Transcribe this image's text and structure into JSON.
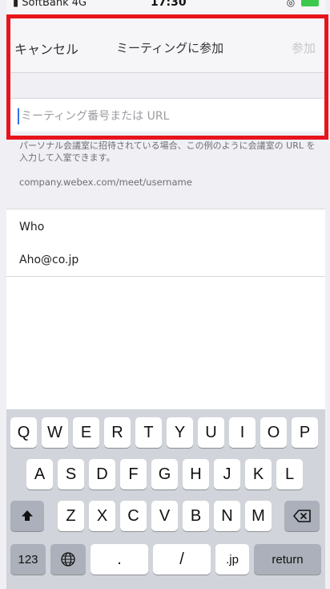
{
  "status_bar": {
    "carrier": "SoftBank",
    "network": "4G",
    "time": "17:30"
  },
  "nav": {
    "cancel_label": "キャンセル",
    "title": "ミーティングに参加",
    "join_label": "参加"
  },
  "meeting_input": {
    "placeholder": "ミーティング番号または URL",
    "value": ""
  },
  "help": {
    "text": "パーソナル会議室に招待されている場合、この例のように会議室の URL を入力して入室できます。",
    "example": "company.webex.com/meet/username"
  },
  "fields": {
    "name_value": "Who",
    "email_value": "Aho@co.jp"
  },
  "keyboard": {
    "row1": [
      "Q",
      "W",
      "E",
      "R",
      "T",
      "Y",
      "U",
      "I",
      "O",
      "P"
    ],
    "row2": [
      "A",
      "S",
      "D",
      "F",
      "G",
      "H",
      "J",
      "K",
      "L"
    ],
    "row3": [
      "Z",
      "X",
      "C",
      "V",
      "B",
      "N",
      "M"
    ],
    "shift_icon": "shift-arrow-icon",
    "delete_icon": "backspace-icon",
    "numbers_label": "123",
    "globe_icon": "globe-icon",
    "period_label": ".",
    "slash_label": "/",
    "jp_label": ".jp",
    "return_label": "return"
  },
  "colors": {
    "highlight_border": "#e8141c",
    "cursor": "#2f72e6",
    "battery": "#3cc94b"
  }
}
